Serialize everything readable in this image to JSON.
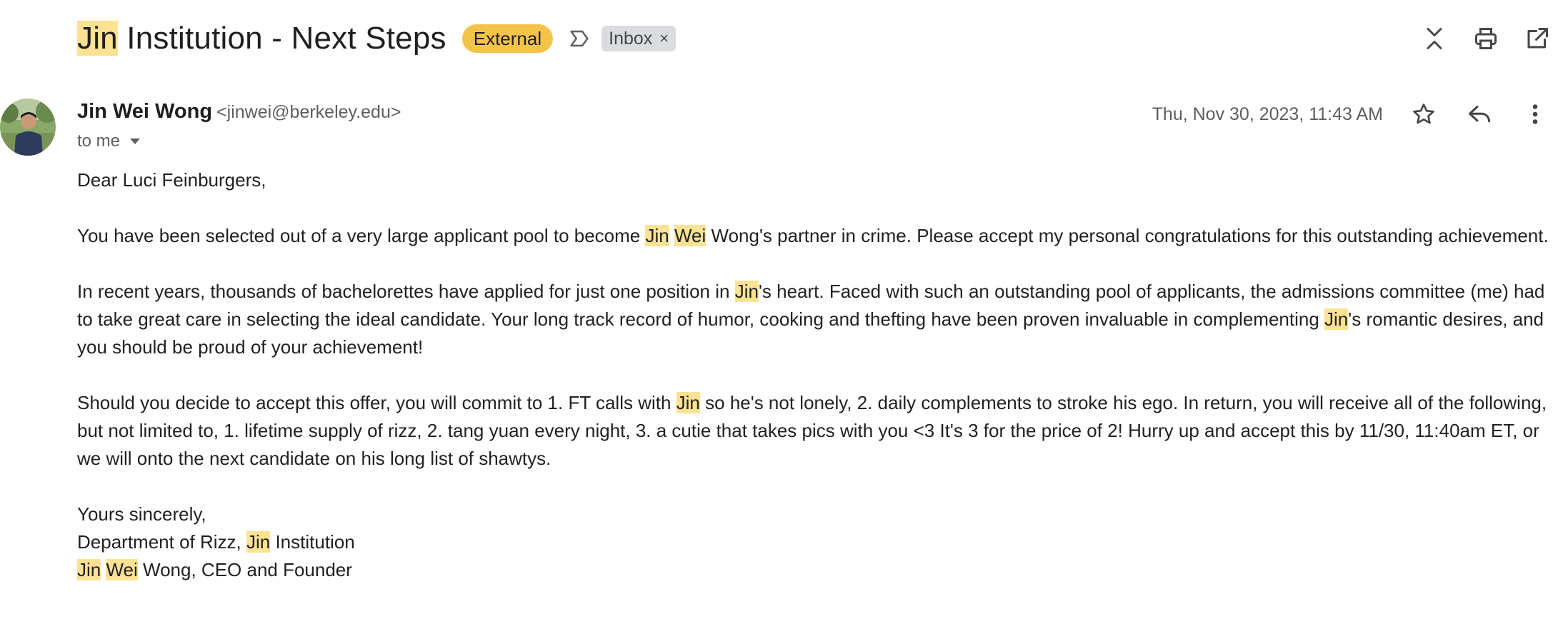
{
  "subject": {
    "highlight": "Jin",
    "rest": " Institution - Next Steps",
    "chip_external": "External",
    "chip_inbox": "Inbox",
    "chip_inbox_close": "×"
  },
  "toolbar": {
    "icons": [
      "collapse-icon",
      "print-icon",
      "open-new-window-icon"
    ]
  },
  "sender": {
    "name": "Jin Wei Wong",
    "email": "<jinwei@berkeley.edu>",
    "to": "to me",
    "date": "Thu, Nov 30, 2023, 11:43 AM",
    "icons": [
      "star-icon",
      "reply-icon",
      "more-vert-icon"
    ]
  },
  "body": {
    "greeting": "Dear Luci Feinburgers,",
    "p1": [
      "You have been selected out of a very large applicant pool to become ",
      "Jin",
      " ",
      "Wei",
      " Wong's partner in crime. Please accept my personal congratulations for this outstanding achievement."
    ],
    "p2": [
      "In recent years, thousands of bachelorettes have applied for just one position in ",
      "Jin",
      "'s heart. Faced with such an outstanding pool of applicants, the admissions committee (me) had to take great care in selecting the ideal candidate. Your long track record of humor, cooking and thefting have been proven invaluable in complementing ",
      "Jin",
      "'s romantic desires, and you should be proud of your achievement!"
    ],
    "p3": [
      "Should you decide to accept this offer, you will commit to 1. FT calls with ",
      "Jin",
      " so he's not lonely, 2. daily complements to stroke his ego. In return, you will receive all of the following, but not limited to, 1. lifetime supply of rizz, 2. tang yuan every night, 3. a cutie that takes pics with you <3 It's 3 for the price of 2! Hurry up and accept this by 11/30, 11:40am ET, or we will onto the next candidate on his long list of shawtys."
    ],
    "closing": "Yours sincerely,",
    "sig1": [
      "Department of Rizz, ",
      "Jin",
      " Institution"
    ],
    "sig2": [
      "Jin",
      " ",
      "Wei",
      " Wong, CEO and Founder"
    ]
  },
  "colors": {
    "highlight": "#fde293",
    "external_chip": "#f4c44a",
    "inbox_chip": "#dadce0"
  }
}
